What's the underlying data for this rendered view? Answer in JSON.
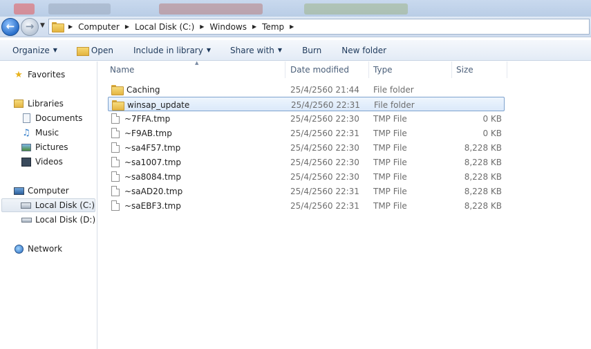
{
  "address": {
    "breadcrumbs": [
      "Computer",
      "Local Disk (C:)",
      "Windows",
      "Temp"
    ]
  },
  "toolbar": {
    "organize": "Organize",
    "open": "Open",
    "include_in_library": "Include in library",
    "share_with": "Share with",
    "burn": "Burn",
    "new_folder": "New folder"
  },
  "nav": {
    "favorites": "Favorites",
    "libraries": "Libraries",
    "documents": "Documents",
    "music": "Music",
    "pictures": "Pictures",
    "videos": "Videos",
    "computer": "Computer",
    "local_c": "Local Disk (C:)",
    "local_d": "Local Disk (D:)",
    "network": "Network"
  },
  "columns": {
    "name": "Name",
    "date": "Date modified",
    "type": "Type",
    "size": "Size"
  },
  "files": [
    {
      "name": "Caching",
      "date": "25/4/2560 21:44",
      "type": "File folder",
      "size": ""
    },
    {
      "name": "winsap_update",
      "date": "25/4/2560 22:31",
      "type": "File folder",
      "size": ""
    },
    {
      "name": "~7FFA.tmp",
      "date": "25/4/2560 22:30",
      "type": "TMP File",
      "size": "0 KB"
    },
    {
      "name": "~F9AB.tmp",
      "date": "25/4/2560 22:31",
      "type": "TMP File",
      "size": "0 KB"
    },
    {
      "name": "~sa4F57.tmp",
      "date": "25/4/2560 22:30",
      "type": "TMP File",
      "size": "8,228 KB"
    },
    {
      "name": "~sa1007.tmp",
      "date": "25/4/2560 22:30",
      "type": "TMP File",
      "size": "8,228 KB"
    },
    {
      "name": "~sa8084.tmp",
      "date": "25/4/2560 22:30",
      "type": "TMP File",
      "size": "8,228 KB"
    },
    {
      "name": "~saAD20.tmp",
      "date": "25/4/2560 22:31",
      "type": "TMP File",
      "size": "8,228 KB"
    },
    {
      "name": "~saEBF3.tmp",
      "date": "25/4/2560 22:31",
      "type": "TMP File",
      "size": "8,228 KB"
    }
  ]
}
